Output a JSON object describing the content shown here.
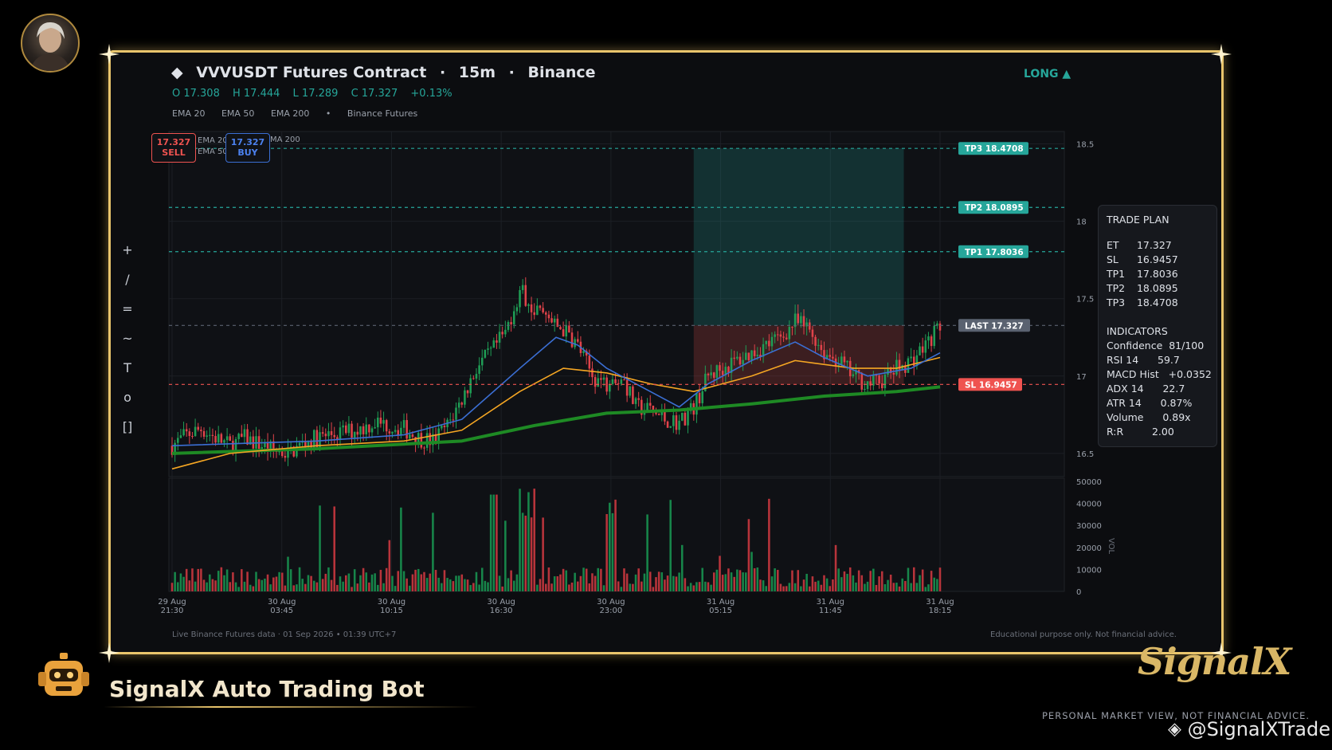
{
  "header": {
    "symbol_title": "VVVUSDT Futures Contract",
    "sep": "·",
    "timeframe": "15m",
    "exchange": "Binance",
    "ohlc": {
      "open": "O 17.308",
      "high": "H 17.444",
      "low": "L 17.289",
      "close": "C 17.327",
      "change": "+0.13%"
    },
    "indicators": [
      "EMA 20",
      "EMA 50",
      "EMA 200",
      "•",
      "Binance Futures"
    ],
    "side": "LONG ▲"
  },
  "toolbar": {
    "tools": [
      "+",
      "/",
      "=",
      "~",
      "T",
      "o",
      "[]"
    ]
  },
  "order_buttons": {
    "sell_price": "17.327",
    "sell_label": "SELL",
    "buy_price": "17.327",
    "buy_label": "BUY",
    "mini_legend": [
      "EMA 20",
      "EMA 50",
      "MA 200"
    ]
  },
  "levels": {
    "tp3": {
      "label": "TP3  18.4708",
      "value": 18.4708,
      "color": "#26a69a"
    },
    "tp2": {
      "label": "TP2  18.0895",
      "value": 18.0895,
      "color": "#26a69a"
    },
    "tp1": {
      "label": "TP1  17.8036",
      "value": 17.8036,
      "color": "#26a69a"
    },
    "last": {
      "label": "LAST  17.327",
      "value": 17.327,
      "color": "#5a6270"
    },
    "sl": {
      "label": "SL  16.9457",
      "value": 16.9457,
      "color": "#ef5350"
    }
  },
  "trade_plan": {
    "title": "TRADE PLAN",
    "rows": [
      {
        "k": "ET",
        "v": "17.327"
      },
      {
        "k": "SL",
        "v": "16.9457"
      },
      {
        "k": "TP1",
        "v": "17.8036"
      },
      {
        "k": "TP2",
        "v": "18.0895"
      },
      {
        "k": "TP3",
        "v": "18.4708"
      }
    ],
    "indicators_title": "INDICATORS",
    "indicators": [
      "Confidence  81/100",
      "RSI 14      59.7",
      "MACD Hist   +0.0352",
      "ADX 14      22.7",
      "ATR 14      0.87%",
      "Volume      0.89x",
      "R:R         2.00"
    ]
  },
  "chart_data": {
    "type": "candlestick",
    "price_axis": {
      "ticks": [
        "18.5",
        "18",
        "17.5",
        "17",
        "16.5"
      ],
      "ylim": [
        16.35,
        18.58
      ]
    },
    "volume_axis": {
      "ticks": [
        "50000",
        "40000",
        "30000",
        "20000",
        "10000",
        "0"
      ],
      "label": "VOL",
      "ylim": [
        0,
        50000
      ]
    },
    "x_ticks": [
      {
        "d": "29 Aug",
        "t": "21:30"
      },
      {
        "d": "30 Aug",
        "t": "03:45"
      },
      {
        "d": "30 Aug",
        "t": "10:15"
      },
      {
        "d": "30 Aug",
        "t": "16:30"
      },
      {
        "d": "30 Aug",
        "t": "23:00"
      },
      {
        "d": "31 Aug",
        "t": "05:15"
      },
      {
        "d": "31 Aug",
        "t": "11:45"
      },
      {
        "d": "31 Aug",
        "t": "18:15"
      }
    ],
    "close_path": [
      [
        0,
        16.55
      ],
      [
        10,
        16.62
      ],
      [
        20,
        16.66
      ],
      [
        30,
        16.6
      ],
      [
        40,
        16.55
      ],
      [
        50,
        16.6
      ],
      [
        60,
        16.56
      ],
      [
        70,
        16.52
      ],
      [
        80,
        16.5
      ],
      [
        90,
        16.56
      ],
      [
        100,
        16.6
      ],
      [
        110,
        16.62
      ],
      [
        120,
        16.64
      ],
      [
        130,
        16.66
      ],
      [
        140,
        16.7
      ],
      [
        150,
        16.68
      ],
      [
        160,
        16.66
      ],
      [
        170,
        16.6
      ],
      [
        180,
        16.58
      ],
      [
        190,
        16.68
      ],
      [
        200,
        16.85
      ],
      [
        210,
        17.05
      ],
      [
        220,
        17.15
      ],
      [
        230,
        17.28
      ],
      [
        240,
        17.55
      ],
      [
        250,
        17.45
      ],
      [
        260,
        17.35
      ],
      [
        270,
        17.3
      ],
      [
        280,
        17.2
      ],
      [
        290,
        17.0
      ],
      [
        300,
        16.95
      ],
      [
        310,
        17.0
      ],
      [
        320,
        16.8
      ],
      [
        330,
        16.78
      ],
      [
        340,
        16.72
      ],
      [
        350,
        16.7
      ],
      [
        360,
        16.8
      ],
      [
        370,
        17.0
      ],
      [
        380,
        17.05
      ],
      [
        390,
        17.1
      ],
      [
        400,
        17.15
      ],
      [
        410,
        17.2
      ],
      [
        420,
        17.25
      ],
      [
        430,
        17.35
      ],
      [
        440,
        17.3
      ],
      [
        450,
        17.15
      ],
      [
        460,
        17.1
      ],
      [
        470,
        17.0
      ],
      [
        480,
        16.95
      ],
      [
        490,
        16.97
      ],
      [
        500,
        17.05
      ],
      [
        510,
        17.1
      ],
      [
        520,
        17.2
      ],
      [
        530,
        17.33
      ]
    ],
    "ema20_path": [
      [
        0,
        16.55
      ],
      [
        100,
        16.58
      ],
      [
        160,
        16.62
      ],
      [
        200,
        16.72
      ],
      [
        240,
        17.05
      ],
      [
        265,
        17.25
      ],
      [
        280,
        17.2
      ],
      [
        300,
        17.05
      ],
      [
        330,
        16.9
      ],
      [
        350,
        16.8
      ],
      [
        370,
        16.95
      ],
      [
        400,
        17.1
      ],
      [
        430,
        17.22
      ],
      [
        450,
        17.12
      ],
      [
        480,
        17.0
      ],
      [
        510,
        17.05
      ],
      [
        530,
        17.15
      ]
    ],
    "ema50_path": [
      [
        0,
        16.4
      ],
      [
        40,
        16.5
      ],
      [
        100,
        16.55
      ],
      [
        160,
        16.58
      ],
      [
        200,
        16.65
      ],
      [
        240,
        16.9
      ],
      [
        270,
        17.05
      ],
      [
        300,
        17.02
      ],
      [
        330,
        16.95
      ],
      [
        360,
        16.9
      ],
      [
        400,
        17.0
      ],
      [
        430,
        17.1
      ],
      [
        470,
        17.05
      ],
      [
        500,
        17.05
      ],
      [
        530,
        17.12
      ]
    ],
    "ema200_path": [
      [
        0,
        16.5
      ],
      [
        100,
        16.53
      ],
      [
        200,
        16.58
      ],
      [
        250,
        16.68
      ],
      [
        300,
        16.76
      ],
      [
        350,
        16.78
      ],
      [
        400,
        16.82
      ],
      [
        450,
        16.87
      ],
      [
        500,
        16.9
      ],
      [
        530,
        16.93
      ]
    ],
    "entry_zone": {
      "x_from": 360,
      "x_to": 505,
      "entry": 17.327,
      "sl": 16.9457,
      "tp": 18.4708
    }
  },
  "footer": {
    "left": "Live Binance Futures data  ·  01 Sep 2026 • 01:39 UTC+7",
    "right": "Educational purpose only. Not financial advice."
  },
  "brand": {
    "bot_name": "SignalX Auto Trading Bot",
    "logo_text": "SignalX",
    "disclaimer": "PERSONAL MARKET VIEW, NOT FINANCIAL ADVICE.",
    "handle": "@SignalXTrader",
    "gold": "#e9c56c"
  }
}
